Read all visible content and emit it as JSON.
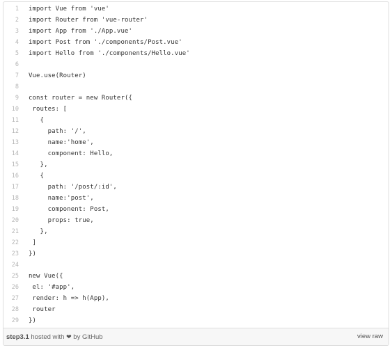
{
  "code": {
    "lines": [
      {
        "num": "1",
        "text": "import Vue from 'vue'"
      },
      {
        "num": "2",
        "text": "import Router from 'vue-router'"
      },
      {
        "num": "3",
        "text": "import App from './App.vue'"
      },
      {
        "num": "4",
        "text": "import Post from './components/Post.vue'"
      },
      {
        "num": "5",
        "text": "import Hello from './components/Hello.vue'"
      },
      {
        "num": "6",
        "text": ""
      },
      {
        "num": "7",
        "text": "Vue.use(Router)"
      },
      {
        "num": "8",
        "text": ""
      },
      {
        "num": "9",
        "text": "const router = new Router({"
      },
      {
        "num": "10",
        "text": " routes: ["
      },
      {
        "num": "11",
        "text": "   {"
      },
      {
        "num": "12",
        "text": "     path: '/',"
      },
      {
        "num": "13",
        "text": "     name:'home',"
      },
      {
        "num": "14",
        "text": "     component: Hello,"
      },
      {
        "num": "15",
        "text": "   },"
      },
      {
        "num": "16",
        "text": "   {"
      },
      {
        "num": "17",
        "text": "     path: '/post/:id',"
      },
      {
        "num": "18",
        "text": "     name:'post',"
      },
      {
        "num": "19",
        "text": "     component: Post,"
      },
      {
        "num": "20",
        "text": "     props: true,"
      },
      {
        "num": "21",
        "text": "   },"
      },
      {
        "num": "22",
        "text": " ]"
      },
      {
        "num": "23",
        "text": "})"
      },
      {
        "num": "24",
        "text": ""
      },
      {
        "num": "25",
        "text": "new Vue({"
      },
      {
        "num": "26",
        "text": " el: '#app',"
      },
      {
        "num": "27",
        "text": " render: h => h(App),"
      },
      {
        "num": "28",
        "text": " router"
      },
      {
        "num": "29",
        "text": "})"
      }
    ]
  },
  "footer": {
    "filename": "step3.1",
    "hosted_with": "hosted with",
    "heart": "❤",
    "by": "by",
    "github": "GitHub",
    "view_raw": "view raw"
  }
}
